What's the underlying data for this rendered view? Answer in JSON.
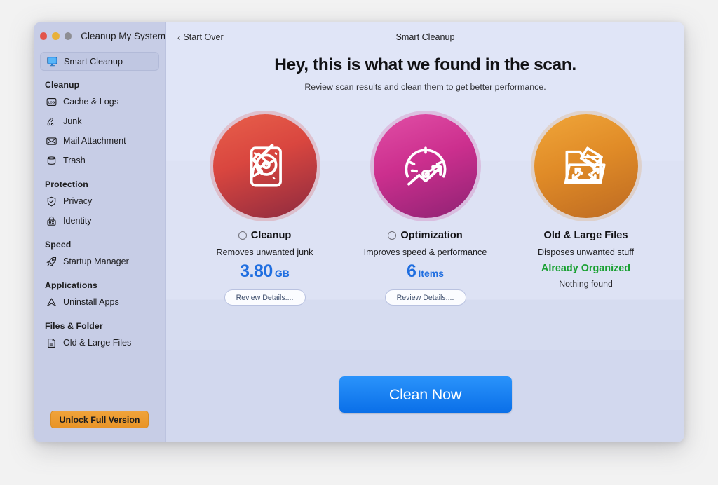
{
  "window": {
    "app_title": "Cleanup My System",
    "traffic_lights": [
      "close-red",
      "minimize-yellow",
      "zoom-gray"
    ]
  },
  "sidebar": {
    "primary_item": {
      "label": "Smart Cleanup",
      "icon": "monitor-icon",
      "selected": true
    },
    "groups": [
      {
        "title": "Cleanup",
        "items": [
          {
            "label": "Cache & Logs",
            "icon": "log-file-icon"
          },
          {
            "label": "Junk",
            "icon": "junk-icon"
          },
          {
            "label": "Mail Attachment",
            "icon": "envelope-icon"
          },
          {
            "label": "Trash",
            "icon": "trash-bin-icon"
          }
        ]
      },
      {
        "title": "Protection",
        "items": [
          {
            "label": "Privacy",
            "icon": "shield-check-icon"
          },
          {
            "label": "Identity",
            "icon": "lock-id-icon"
          }
        ]
      },
      {
        "title": "Speed",
        "items": [
          {
            "label": "Startup Manager",
            "icon": "rocket-icon"
          }
        ]
      },
      {
        "title": "Applications",
        "items": [
          {
            "label": "Uninstall Apps",
            "icon": "app-chevron-icon"
          }
        ]
      },
      {
        "title": "Files & Folder",
        "items": [
          {
            "label": "Old & Large Files",
            "icon": "document-icon"
          }
        ]
      }
    ],
    "unlock_button": "Unlock Full Version"
  },
  "toolbar": {
    "back_label": "Start Over",
    "back_icon": "chevron-left-icon",
    "title": "Smart Cleanup"
  },
  "main": {
    "headline": "Hey, this is what we found in the scan.",
    "subhead": "Review scan results and clean them to get better performance.",
    "cards": [
      {
        "id": "cleanup",
        "icon": "broom-harddrive-icon",
        "title": "Cleanup",
        "description": "Removes unwanted junk",
        "value": "3.80",
        "unit": "GB",
        "has_radio": true,
        "radio_checked": false,
        "action_label": "Review Details....",
        "accent": "#d9463f"
      },
      {
        "id": "optimization",
        "icon": "speedometer-growth-icon",
        "title": "Optimization",
        "description": "Improves speed & performance",
        "value": "6",
        "unit": "Items",
        "has_radio": true,
        "radio_checked": false,
        "action_label": "Review Details....",
        "accent": "#cc2f8e"
      },
      {
        "id": "old-large-files",
        "icon": "folder-resize-icon",
        "title": "Old & Large Files",
        "description": "Disposes unwanted stuff",
        "status": "Already Organized",
        "status_sub": "Nothing found",
        "has_radio": false,
        "accent": "#e08b27",
        "status_color": "#18a031"
      }
    ],
    "primary_action": "Clean Now"
  },
  "colors": {
    "value_blue": "#1f6ee0",
    "clean_now_blue": "#0a6fe8",
    "unlock_orange": "#e89428",
    "sidebar_bg": "#c7cde6",
    "main_bg": "#dfe4f6"
  }
}
